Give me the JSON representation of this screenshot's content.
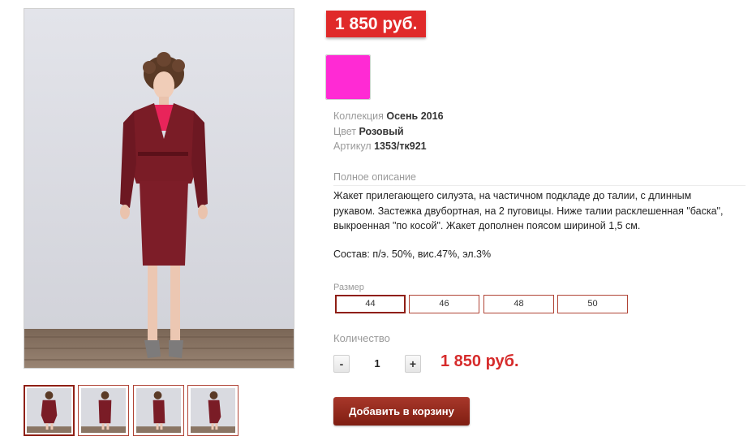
{
  "product": {
    "price_badge": "1 850 руб.",
    "color_swatch": "#ff2ad4",
    "meta": {
      "collection_label": "Коллекция",
      "collection_value": "Осень 2016",
      "color_label": "Цвет",
      "color_value": "Розовый",
      "sku_label": "Артикул",
      "sku_value": "1353/тк921"
    },
    "description_title": "Полное описание",
    "description_lines": [
      "Жакет прилегающего силуэта, на частичном подкладе до талии, с длинным",
      "рукавом. Застежка двубортная, на 2 пуговицы. Ниже талии расклешенная \"баска\",",
      "выкроенная \"по косой\". Жакет дополнен поясом шириной 1,5 см."
    ],
    "composition": "Состав: п/э. 50%, вис.47%, эл.3%",
    "size_label": "Размер",
    "sizes": [
      "44",
      "46",
      "48",
      "50"
    ],
    "selected_size": "44",
    "quantity_label": "Количество",
    "quantity_minus": "-",
    "quantity_value": "1",
    "quantity_plus": "+",
    "total_price": "1 850 руб.",
    "add_to_cart": "Добавить в корзину",
    "colors": {
      "accent": "#e02a2a",
      "garment": "#7a1c26",
      "button": "#8f1f15"
    }
  }
}
